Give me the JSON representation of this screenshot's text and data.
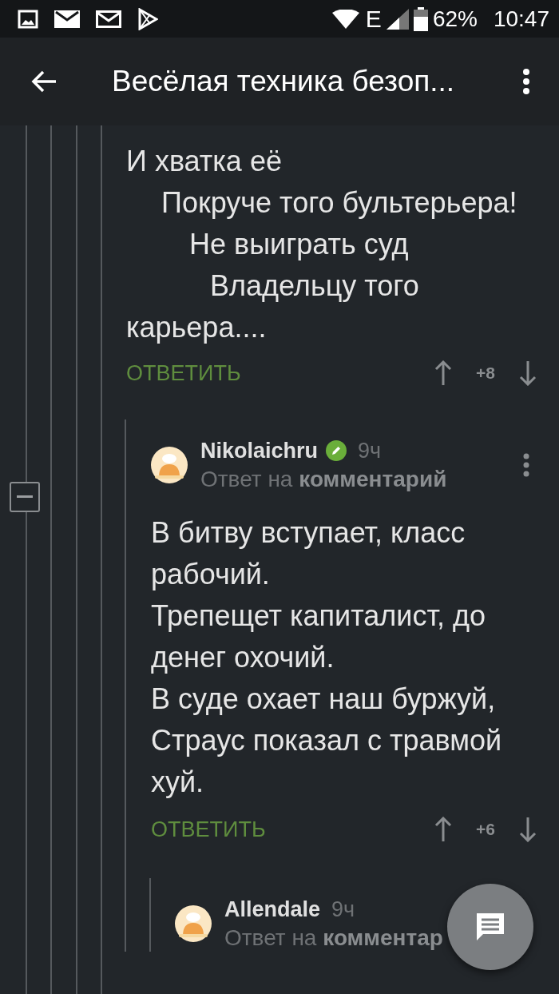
{
  "status_bar": {
    "network": "E",
    "battery": "62%",
    "time": "10:47"
  },
  "app_bar": {
    "title": "Весёлая техника безоп..."
  },
  "comments": [
    {
      "kind": "continued",
      "lines": [
        "И хватка её",
        "Покруче того бультерьера!",
        "Не выиграть суд",
        "Владельцу того",
        "карьера...."
      ],
      "reply_label": "ОТВЕТИТЬ",
      "score": "+8"
    },
    {
      "kind": "reply",
      "author": "Nikolaichru",
      "badge": true,
      "time": "9ч",
      "reply_to": "Ответ на **комментарий**",
      "lines": [
        "В битву вступает, класс рабочий.",
        "Трепещет капиталист, до денег охочий.",
        "В суде охает наш буржуй,",
        "Страус показал с травмой хуй."
      ],
      "reply_label": "ОТВЕТИТЬ",
      "score": "+6"
    },
    {
      "kind": "reply",
      "author": "Allendale",
      "badge": false,
      "time": "9ч",
      "reply_to": "Ответ на **комментар**"
    }
  ]
}
